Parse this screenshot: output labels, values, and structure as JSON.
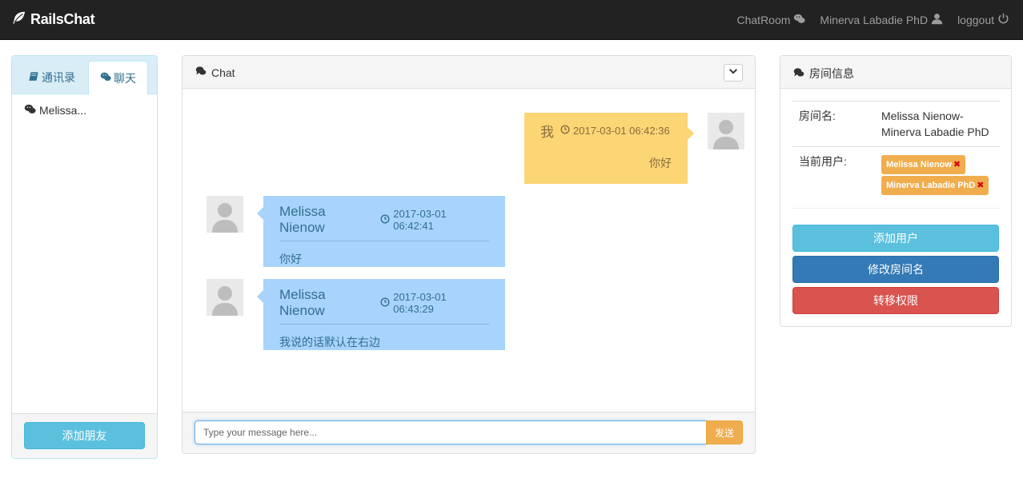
{
  "navbar": {
    "brand": "RailsChat",
    "links": [
      {
        "label": "ChatRoom",
        "icon": "wechat-icon"
      },
      {
        "label": "Minerva Labadie PhD",
        "icon": "user-icon"
      },
      {
        "label": "loggout",
        "icon": "power-icon"
      }
    ]
  },
  "left_panel": {
    "tabs": [
      {
        "label": "通讯录",
        "icon": "book-icon",
        "active": false
      },
      {
        "label": "聊天",
        "icon": "wechat-icon",
        "active": true
      }
    ],
    "friends": [
      {
        "name": "Melissa..."
      }
    ],
    "add_friend_label": "添加朋友"
  },
  "chat_panel": {
    "title": "Chat",
    "messages": [
      {
        "sender": "我",
        "time": "2017-03-01 06:42:36",
        "text": "你好",
        "side": "right"
      },
      {
        "sender": "Melissa Nienow",
        "time": "2017-03-01 06:42:41",
        "text": "你好",
        "side": "left"
      },
      {
        "sender": "Melissa Nienow",
        "time": "2017-03-01 06:43:29",
        "text": "我说的话默认在右边",
        "side": "left"
      }
    ],
    "input_placeholder": "Type your message here...",
    "send_label": "发送"
  },
  "room_panel": {
    "title": "房间信息",
    "room_name_label": "房间名:",
    "room_name_line1": "Melissa Nienow-",
    "room_name_line2": "Minerva Labadie PhD",
    "current_users_label": "当前用户:",
    "users": [
      "Melissa Nienow",
      "Minerva Labadie PhD"
    ],
    "buttons": {
      "add_user": "添加用户",
      "rename_room": "修改房间名",
      "transfer_permission": "转移权限"
    }
  },
  "colors": {
    "navbar_bg": "#222222",
    "my_bubble": "#fcd575",
    "other_bubble": "#a8d3fc",
    "info_button": "#5bc0de",
    "primary_button": "#337ab7",
    "danger_button": "#d9534f",
    "send_button": "#f0ad4e"
  }
}
